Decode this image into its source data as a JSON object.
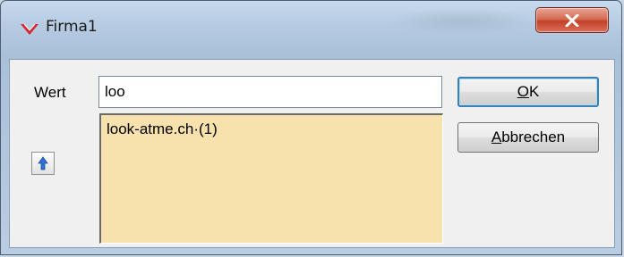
{
  "window": {
    "title": "Firma1",
    "close_icon": "close-x-icon",
    "app_icon": "red-chevron-logo-icon"
  },
  "form": {
    "field_label": "Wert",
    "field_value": "loo",
    "list_items": [
      "look-atme.ch·(1)"
    ],
    "up_icon": "arrow-up-icon"
  },
  "buttons": {
    "ok_label_underlined": "O",
    "ok_label_rest": "K",
    "cancel_label_underlined": "A",
    "cancel_label_rest": "bbrechen"
  },
  "colors": {
    "list_background": "#f7e1ac",
    "close_button": "#c34228",
    "app_icon": "#d8232a",
    "up_arrow": "#2f6fd0"
  }
}
